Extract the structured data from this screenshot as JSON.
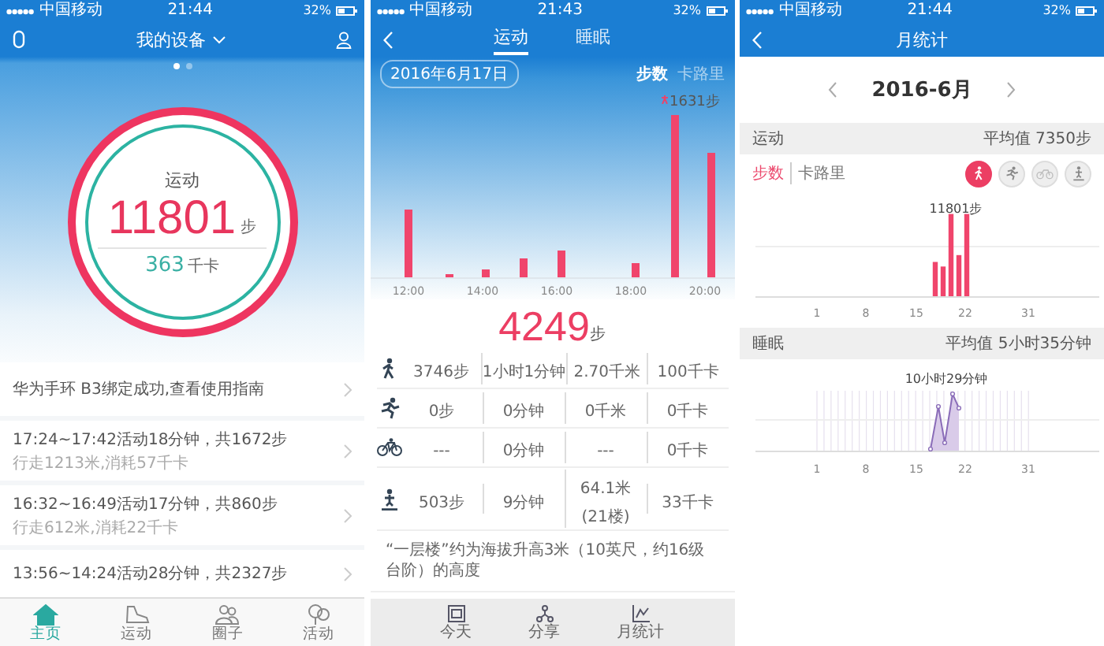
{
  "home_screen": {
    "status_bar": {
      "carrier": "中国移动",
      "time": "21:44",
      "battery": "32%"
    },
    "title": "我的设备",
    "page_dots": [
      {
        "selected": true
      },
      {
        "selected": false
      }
    ],
    "activity": {
      "label": "运动",
      "steps": "11801",
      "steps_unit": "步",
      "calories": "363",
      "calories_unit": "千卡"
    },
    "notice": "华为手环 B3绑定成功,查看使用指南",
    "records": [
      {
        "title": "17:24~17:42活动18分钟，共1672步",
        "detail": "行走1213米,消耗57千卡"
      },
      {
        "title": "16:32~16:49活动17分钟，共860步",
        "detail": "行走612米,消耗22千卡"
      },
      {
        "title": "13:56~14:24活动28分钟，共2327步"
      }
    ],
    "tab_bar": [
      {
        "label": "主页",
        "kind": "home",
        "selected": true
      },
      {
        "label": "运动",
        "kind": "shoe",
        "selected": false
      },
      {
        "label": "圈子",
        "kind": "people",
        "selected": false
      },
      {
        "label": "活动",
        "kind": "balloons",
        "selected": false
      }
    ]
  },
  "day_screen": {
    "status_bar": {
      "carrier": "中国移动",
      "time": "21:43",
      "battery": "32%"
    },
    "tabs": [
      {
        "label": "运动",
        "selected": true
      },
      {
        "label": "睡眠",
        "selected": false
      }
    ],
    "date": "2016年6月17日",
    "metric_toggle": [
      {
        "label": "步数",
        "selected": true
      },
      {
        "label": "卡路里",
        "selected": false
      }
    ],
    "chart_peak_label": "1631步",
    "chart_x_labels": [
      "12:00",
      "14:00",
      "16:00",
      "18:00",
      "20:00"
    ],
    "total_steps": "4249",
    "total_unit": "步",
    "rows": [
      {
        "kind": "walk",
        "cells": [
          [
            "3746步"
          ],
          [
            "1小时1分钟"
          ],
          [
            "2.70千米"
          ],
          [
            "100千卡"
          ]
        ]
      },
      {
        "kind": "run",
        "cells": [
          [
            "0步"
          ],
          [
            "0分钟"
          ],
          [
            "0千米"
          ],
          [
            "0千卡"
          ]
        ]
      },
      {
        "kind": "cycle",
        "cells": [
          [
            "---"
          ],
          [
            "0分钟"
          ],
          [
            "---"
          ],
          [
            "0千卡"
          ]
        ]
      },
      {
        "kind": "climb",
        "cells": [
          [
            "503步"
          ],
          [
            "9分钟"
          ],
          [
            "64.1米",
            "(21楼)"
          ],
          [
            "33千卡"
          ]
        ]
      }
    ],
    "footnote": "“一层楼”约为海拔升高3米（10英尺，约16级台阶）的高度",
    "bottom_bar": [
      {
        "label": "今天",
        "kind": "calendar"
      },
      {
        "label": "分享",
        "kind": "share"
      },
      {
        "label": "月统计",
        "kind": "chart"
      }
    ]
  },
  "month_screen": {
    "status_bar": {
      "carrier": "中国移动",
      "time": "21:44",
      "battery": "32%"
    },
    "title": "月统计",
    "month": "2016-6月",
    "activity_section": {
      "title": "运动",
      "average": "平均值 7350步",
      "metric_toggle": [
        {
          "label": "步数",
          "selected": true
        },
        {
          "label": "卡路里",
          "selected": false
        }
      ],
      "filters": [
        {
          "kind": "walk",
          "selected": true
        },
        {
          "kind": "run",
          "selected": false
        },
        {
          "kind": "cycle",
          "selected": false
        },
        {
          "kind": "climb",
          "selected": false
        }
      ],
      "peak_label": "11801步",
      "x_labels": [
        "1",
        "8",
        "15",
        "22",
        "31"
      ]
    },
    "sleep_section": {
      "title": "睡眠",
      "average": "平均值 5小时35分钟",
      "peak_label": "10小时29分钟",
      "x_labels": [
        "1",
        "8",
        "15",
        "22",
        "31"
      ]
    }
  }
}
